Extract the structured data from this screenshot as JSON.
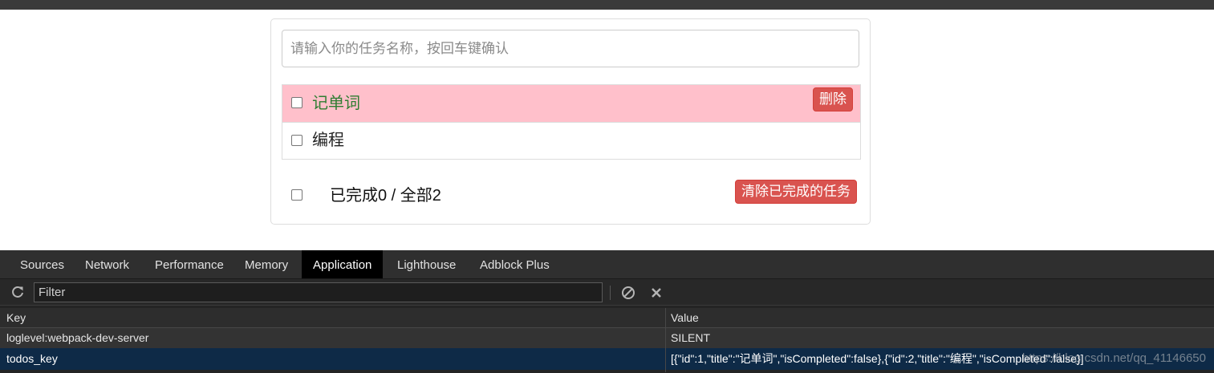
{
  "todo": {
    "input_placeholder": "请输入你的任务名称，按回车键确认",
    "items": [
      {
        "title": "记单词",
        "completed": false,
        "delete_label": "删除"
      },
      {
        "title": "编程",
        "completed": false
      }
    ],
    "footer": {
      "summary": "已完成0 / 全部2",
      "clear_label": "清除已完成的任务"
    }
  },
  "devtools": {
    "tabs": [
      "Sources",
      "Network",
      "Performance",
      "Memory",
      "Application",
      "Lighthouse",
      "Adblock Plus"
    ],
    "active_tab": "Application",
    "toolbar": {
      "refresh_icon": "refresh-icon",
      "filter_placeholder": "Filter",
      "clear_icon": "block-icon",
      "delete_icon": "close-icon"
    },
    "table": {
      "headers": {
        "key": "Key",
        "value": "Value"
      },
      "rows": [
        {
          "key": "loglevel:webpack-dev-server",
          "value": "SILENT"
        },
        {
          "key": "todos_key",
          "value": "[{\"id\":1,\"title\":\"记单词\",\"isCompleted\":false},{\"id\":2,\"title\":\"编程\",\"isCompleted\":false}]"
        }
      ]
    },
    "watermark": "https://blog.csdn.net/qq_41146650"
  },
  "colors": {
    "highlight_row": "#ffc0cb",
    "danger": "#d9534f",
    "active_title": "#2e7d32",
    "selected_row": "#0e2a47"
  }
}
